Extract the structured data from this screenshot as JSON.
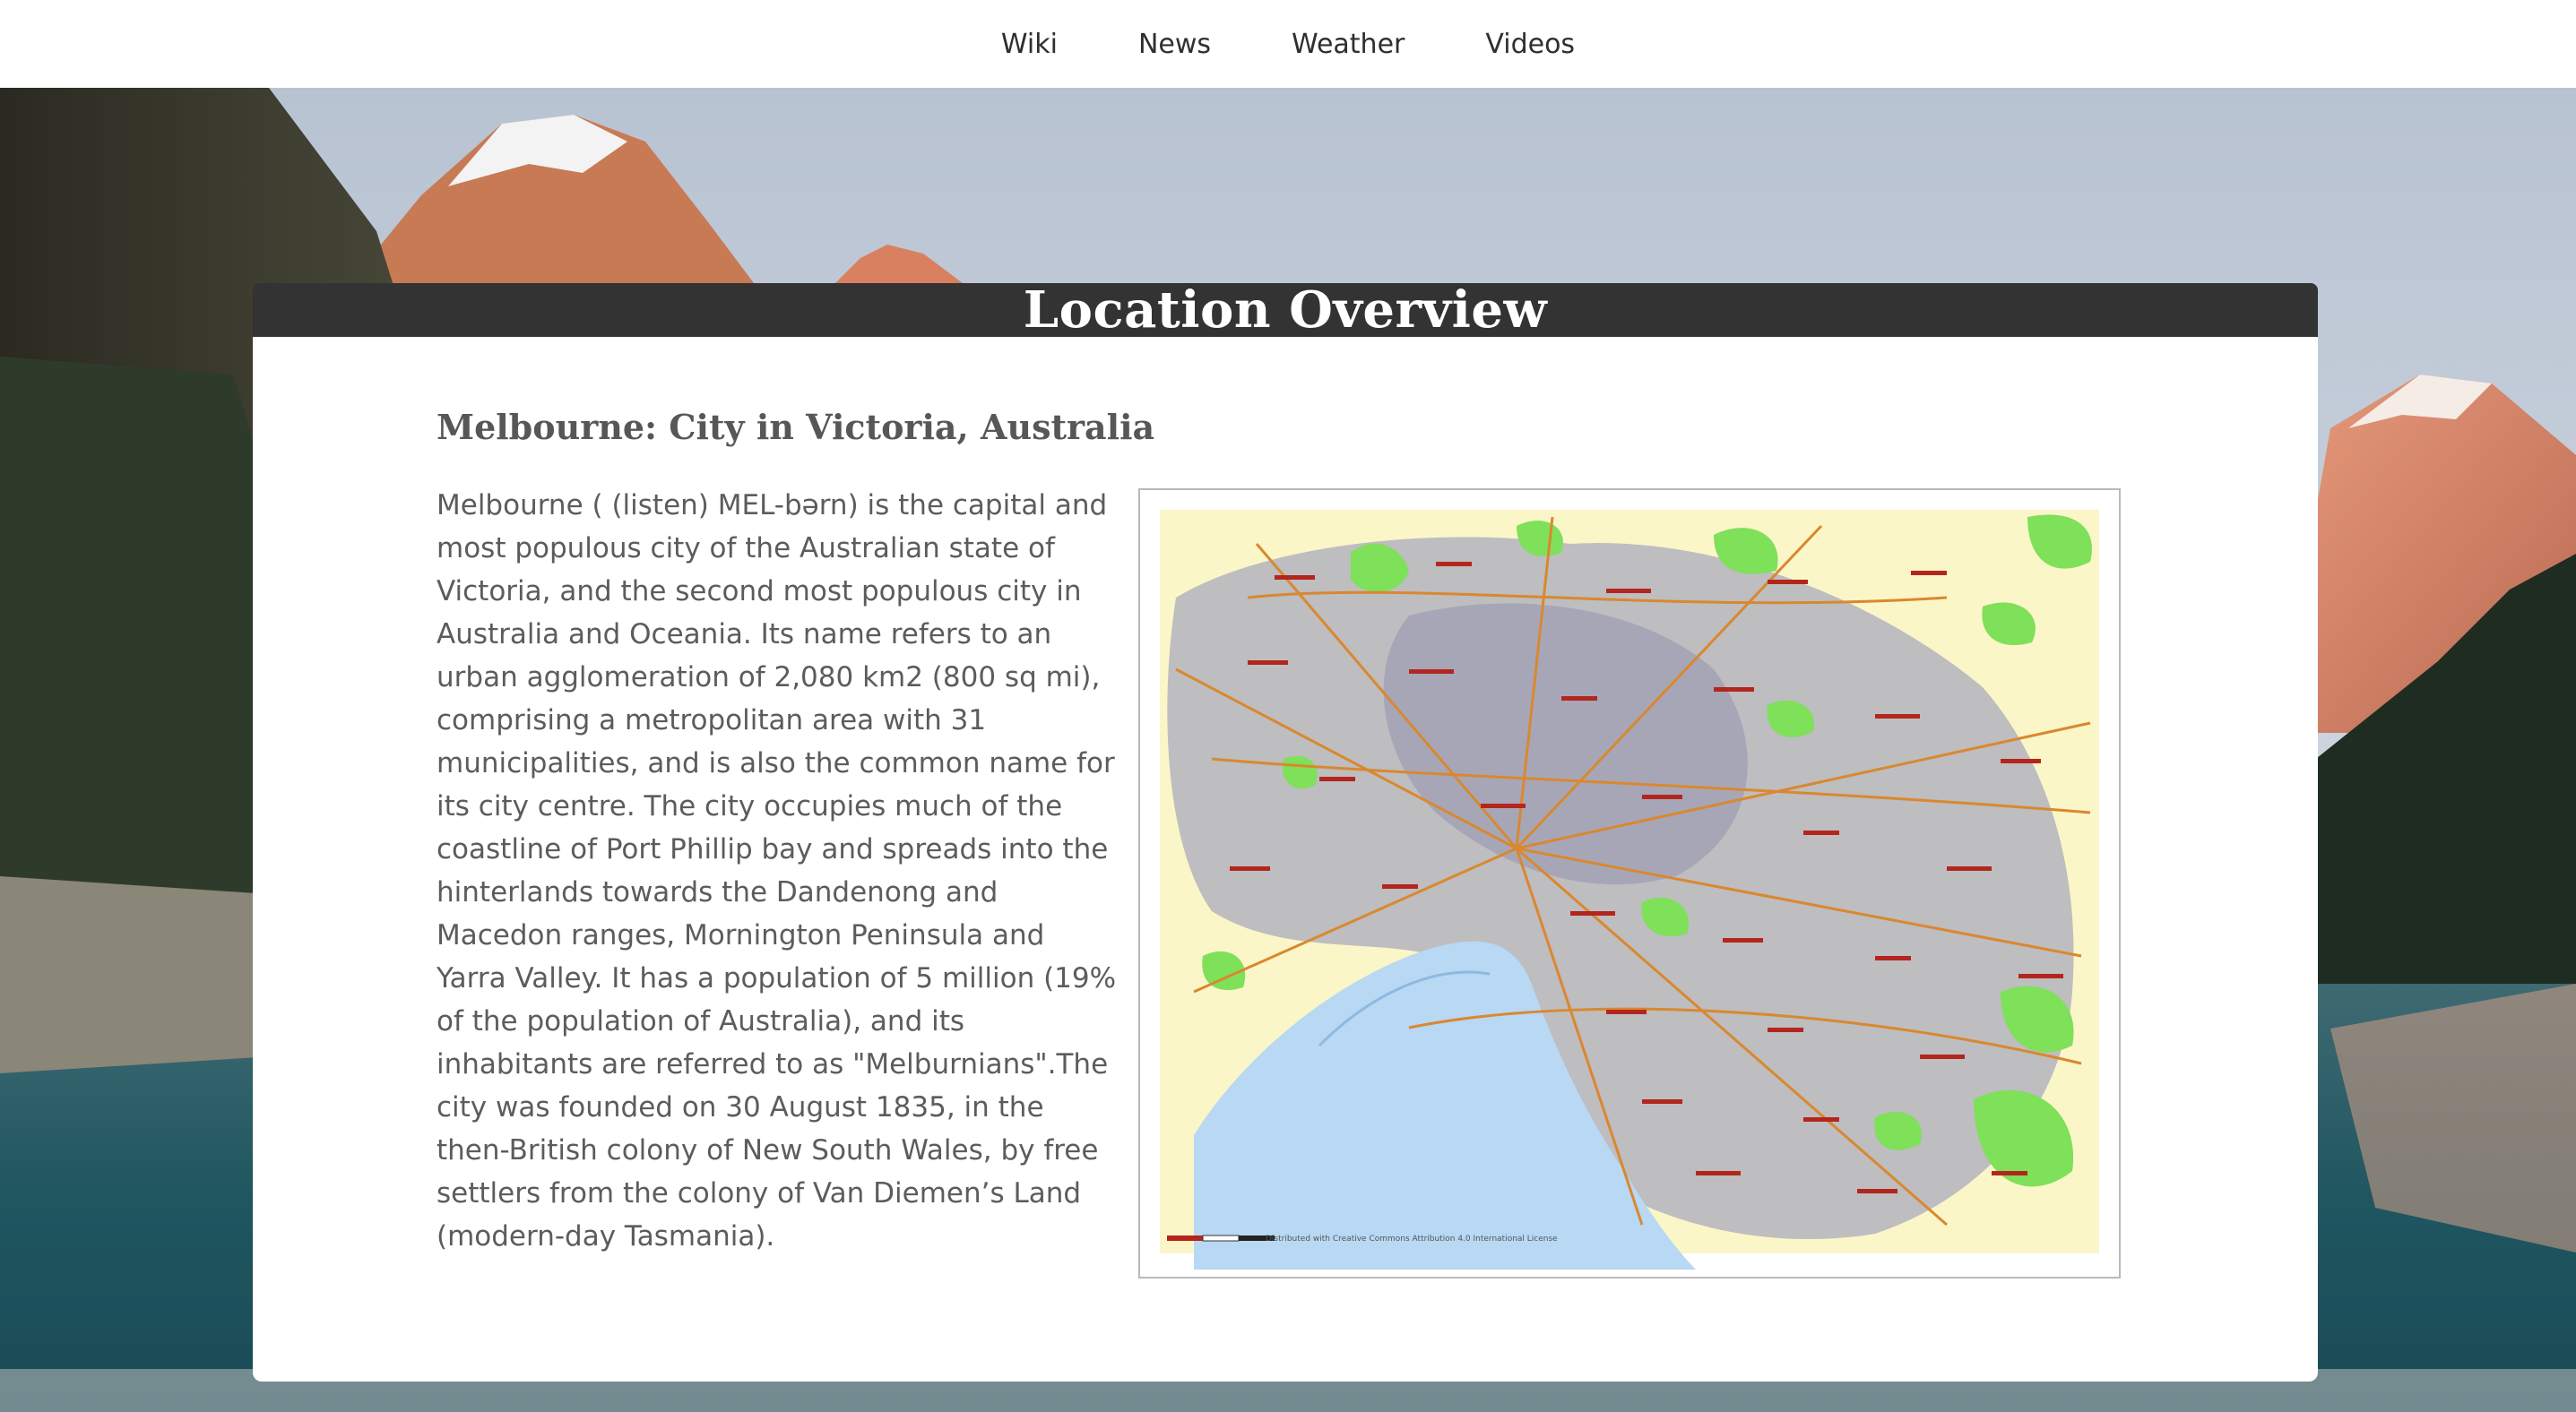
{
  "nav": {
    "items": [
      {
        "label": "Wiki"
      },
      {
        "label": "News"
      },
      {
        "label": "Weather"
      },
      {
        "label": "Videos"
      }
    ]
  },
  "page": {
    "title": "Location Overview"
  },
  "location": {
    "heading": "Melbourne: City in Victoria, Australia",
    "description": "Melbourne ( (listen) MEL-bərn) is the capital and most populous city of the Australian state of Victoria, and the second most populous city in Australia and Oceania. Its name refers to an urban agglomeration of 2,080 km2 (800 sq mi), comprising a metropolitan area with 31 municipalities, and is also the common name for its city centre. The city occupies much of the coastline of Port Phillip bay and spreads into the hinterlands towards the Dandenong and Macedon ranges, Mornington Peninsula and Yarra Valley. It has a population of 5 million (19% of the population of Australia), and its inhabitants are referred to as \"Melburnians\".The city was founded on 30 August 1835, in the then-British colony of New South Wales, by free settlers from the colony of Van Diemen’s Land (modern-day Tasmania)."
  },
  "map": {
    "credit": "Distributed with Creative Commons Attribution 4.0 International License"
  },
  "colors": {
    "nav_bg": "#ffffff",
    "title_bar": "#333333",
    "card_bg": "#ffffff",
    "heading_text": "#575757",
    "body_text": "#5c5c5c",
    "map_land": "#fbf6c8",
    "map_water": "#b8d8f4",
    "map_urban": "#a9a9bd",
    "map_park": "#7fe05a",
    "map_road": "#d9882f",
    "map_label": "#b3261e"
  }
}
